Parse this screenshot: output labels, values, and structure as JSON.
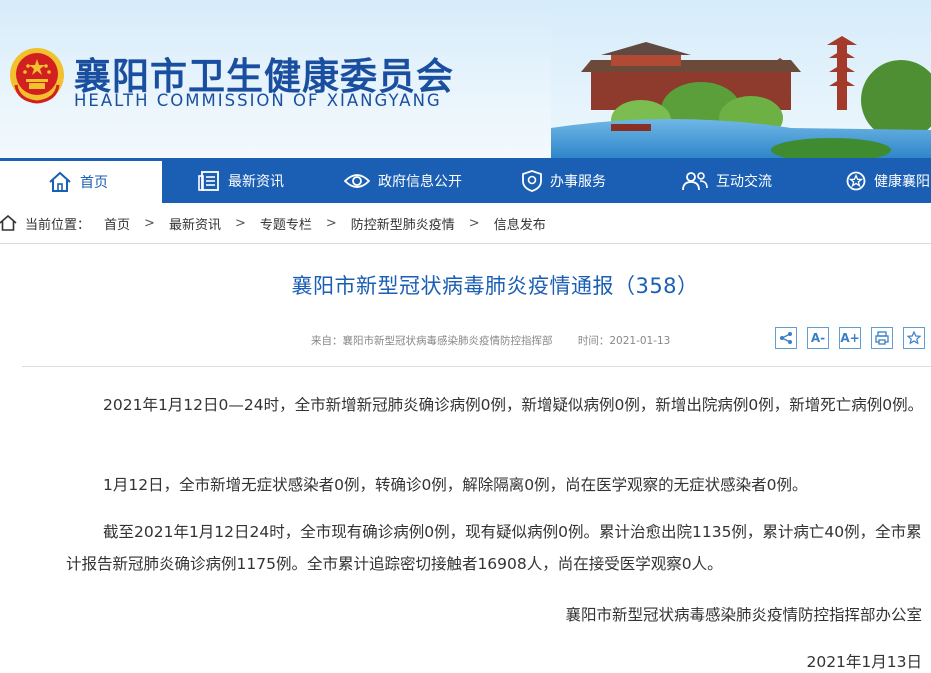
{
  "header": {
    "title": "襄阳市卫生健康委员会",
    "subtitle": "HEALTH COMMISSION OF XIANGYANG"
  },
  "nav": {
    "items": [
      {
        "label": "首页",
        "icon": "home-icon",
        "active": true
      },
      {
        "label": "最新资讯",
        "icon": "news-icon"
      },
      {
        "label": "政府信息公开",
        "icon": "eye-icon"
      },
      {
        "label": "办事服务",
        "icon": "shield-icon"
      },
      {
        "label": "互动交流",
        "icon": "users-icon"
      },
      {
        "label": "健康襄阳",
        "icon": "star-badge-icon"
      }
    ]
  },
  "breadcrumb": {
    "prefix": "当前位置：",
    "items": [
      "首页",
      "最新资讯",
      "专题专栏",
      "防控新型肺炎疫情",
      "信息发布"
    ],
    "separator": ">"
  },
  "article": {
    "title": "襄阳市新型冠状病毒肺炎疫情通报（358）",
    "source": "来自：襄阳市新型冠状病毒感染肺炎疫情防控指挥部",
    "time": "时间：2021-01-13",
    "paragraphs": [
      "2021年1月12日0—24时，全市新增新冠肺炎确诊病例0例，新增疑似病例0例，新增出院病例0例，新增死亡病例0例。",
      "1月12日，全市新增无症状感染者0例，转确诊0例，解除隔离0例，尚在医学观察的无症状感染者0例。",
      "截至2021年1月12日24时，全市现有确诊病例0例，现有疑似病例0例。累计治愈出院1135例，累计病亡40例，全市累计报告新冠肺炎确诊病例1175例。全市累计追踪密切接触者16908人，尚在接受医学观察0人。"
    ],
    "signature": "襄阳市新型冠状病毒感染肺炎疫情防控指挥部办公室",
    "date": "2021年1月13日"
  },
  "tools": {
    "share": "<",
    "font_decrease": "A-",
    "font_increase": "A+",
    "print_icon": "print-icon",
    "favorite_icon": "star-icon"
  },
  "colors": {
    "brand_blue": "#1b5fb4",
    "title_blue": "#1a4fa0",
    "emblem_red": "#d21f1f",
    "emblem_gold": "#f2c12e"
  }
}
